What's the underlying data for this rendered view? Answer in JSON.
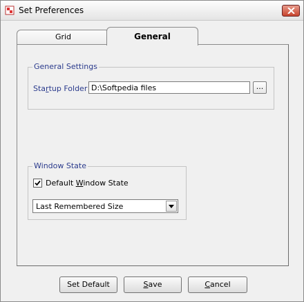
{
  "window": {
    "title": "Set Preferences"
  },
  "tabs": [
    {
      "label": "Grid",
      "active": false
    },
    {
      "label": "General",
      "active": true
    }
  ],
  "general_settings": {
    "legend": "General Settings",
    "startup_label_pre": "Sta",
    "startup_label_access": "r",
    "startup_label_post": "tup Folder",
    "startup_value": "D:\\Softpedia files",
    "browse_label": "..."
  },
  "window_state": {
    "legend": "Window State",
    "checkbox_pre": "Default ",
    "checkbox_access": "W",
    "checkbox_post": "indow State",
    "checked": true,
    "select_value": "Last Remembered Size"
  },
  "buttons": {
    "set_default": "Set Default",
    "save_access": "S",
    "save_rest": "ave",
    "cancel_access": "C",
    "cancel_rest": "ancel"
  },
  "colors": {
    "group_label": "#2a3a8c",
    "close_button": "#c8452f"
  },
  "icons": [
    "app-icon",
    "close-icon",
    "check-icon",
    "dropdown-arrow-icon"
  ]
}
